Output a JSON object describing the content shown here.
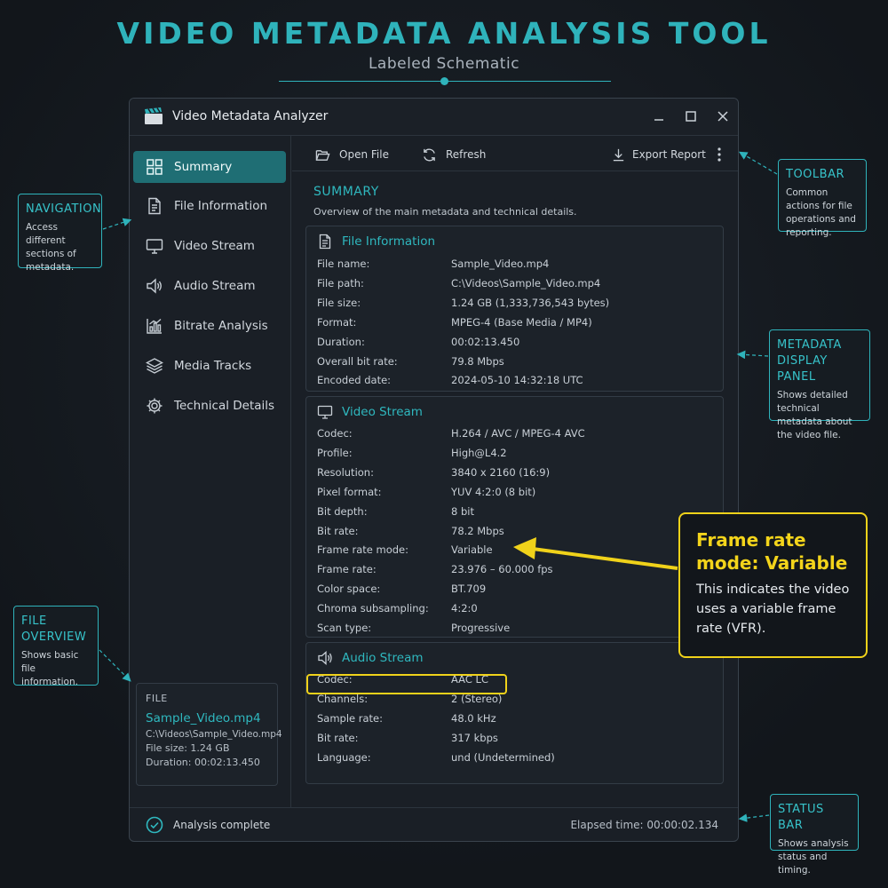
{
  "header": {
    "title": "VIDEO METADATA ANALYSIS TOOL",
    "subtitle": "Labeled Schematic"
  },
  "window": {
    "title": "Video Metadata Analyzer",
    "app_icon": "clapperboard-icon"
  },
  "sidebar": {
    "items": [
      {
        "label": "Summary",
        "icon": "grid-icon",
        "active": true
      },
      {
        "label": "File Information",
        "icon": "document-icon",
        "active": false
      },
      {
        "label": "Video Stream",
        "icon": "monitor-icon",
        "active": false
      },
      {
        "label": "Audio Stream",
        "icon": "speaker-icon",
        "active": false
      },
      {
        "label": "Bitrate Analysis",
        "icon": "bar-chart-icon",
        "active": false
      },
      {
        "label": "Media Tracks",
        "icon": "layers-icon",
        "active": false
      },
      {
        "label": "Technical Details",
        "icon": "gear-icon",
        "active": false
      }
    ],
    "file_card": {
      "heading": "FILE",
      "name": "Sample_Video.mp4",
      "path": "C:\\Videos\\Sample_Video.mp4",
      "size_line": "File size:  1.24 GB",
      "duration_line": "Duration:  00:02:13.450"
    }
  },
  "toolbar": {
    "open_label": "Open File",
    "refresh_label": "Refresh",
    "export_label": "Export Report"
  },
  "summary": {
    "title": "SUMMARY",
    "description": "Overview of the main metadata and technical details."
  },
  "file_info": {
    "title": "File Information",
    "rows": [
      {
        "key": "File name:",
        "value": "Sample_Video.mp4"
      },
      {
        "key": "File path:",
        "value": "C:\\Videos\\Sample_Video.mp4"
      },
      {
        "key": "File size:",
        "value": "1.24 GB (1,333,736,543 bytes)"
      },
      {
        "key": "Format:",
        "value": "MPEG-4 (Base Media / MP4)"
      },
      {
        "key": "Duration:",
        "value": "00:02:13.450"
      },
      {
        "key": "Overall bit rate:",
        "value": "79.8 Mbps"
      },
      {
        "key": "Encoded date:",
        "value": "2024-05-10 14:32:18  UTC"
      }
    ]
  },
  "video_stream": {
    "title": "Video Stream",
    "rows": [
      {
        "key": "Codec:",
        "value": "H.264 / AVC / MPEG-4 AVC"
      },
      {
        "key": "Profile:",
        "value": "High@L4.2"
      },
      {
        "key": "Resolution:",
        "value": "3840 x 2160 (16:9)"
      },
      {
        "key": "Pixel format:",
        "value": "YUV 4:2:0 (8 bit)"
      },
      {
        "key": "Bit depth:",
        "value": "8 bit"
      },
      {
        "key": "Bit rate:",
        "value": "78.2 Mbps"
      },
      {
        "key": "Frame rate mode:",
        "value": "Variable"
      },
      {
        "key": "Frame rate:",
        "value": "23.976 – 60.000 fps"
      },
      {
        "key": "Color space:",
        "value": "BT.709"
      },
      {
        "key": "Chroma subsampling:",
        "value": "4:2:0"
      },
      {
        "key": "Scan type:",
        "value": "Progressive"
      }
    ]
  },
  "audio_stream": {
    "title": "Audio Stream",
    "rows": [
      {
        "key": "Codec:",
        "value": "AAC LC"
      },
      {
        "key": "Channels:",
        "value": "2 (Stereo)"
      },
      {
        "key": "Sample rate:",
        "value": "48.0 kHz"
      },
      {
        "key": "Bit rate:",
        "value": "317 kbps"
      },
      {
        "key": "Language:",
        "value": "und (Undetermined)"
      }
    ]
  },
  "status": {
    "text": "Analysis complete",
    "elapsed": "Elapsed time:  00:00:02.134"
  },
  "callouts": {
    "navigation": {
      "title": "NAVIGATION",
      "body": "Access different sections of metadata."
    },
    "file_overview": {
      "title": "FILE OVERVIEW",
      "body": "Shows basic file information."
    },
    "toolbar": {
      "title": "TOOLBAR",
      "body": "Common actions for file operations and reporting."
    },
    "metadata_panel": {
      "title": "METADATA DISPLAY PANEL",
      "body": "Shows detailed technical metadata about the video file."
    },
    "status_bar": {
      "title": "STATUS BAR",
      "body": "Shows analysis status and timing."
    },
    "frame_rate": {
      "title": "Frame rate mode: Variable",
      "body": "This indicates the video uses a variable frame rate (VFR)."
    }
  },
  "colors": {
    "accent": "#2fb3bb",
    "highlight": "#f0d21a",
    "active_nav": "#1f6e74"
  }
}
